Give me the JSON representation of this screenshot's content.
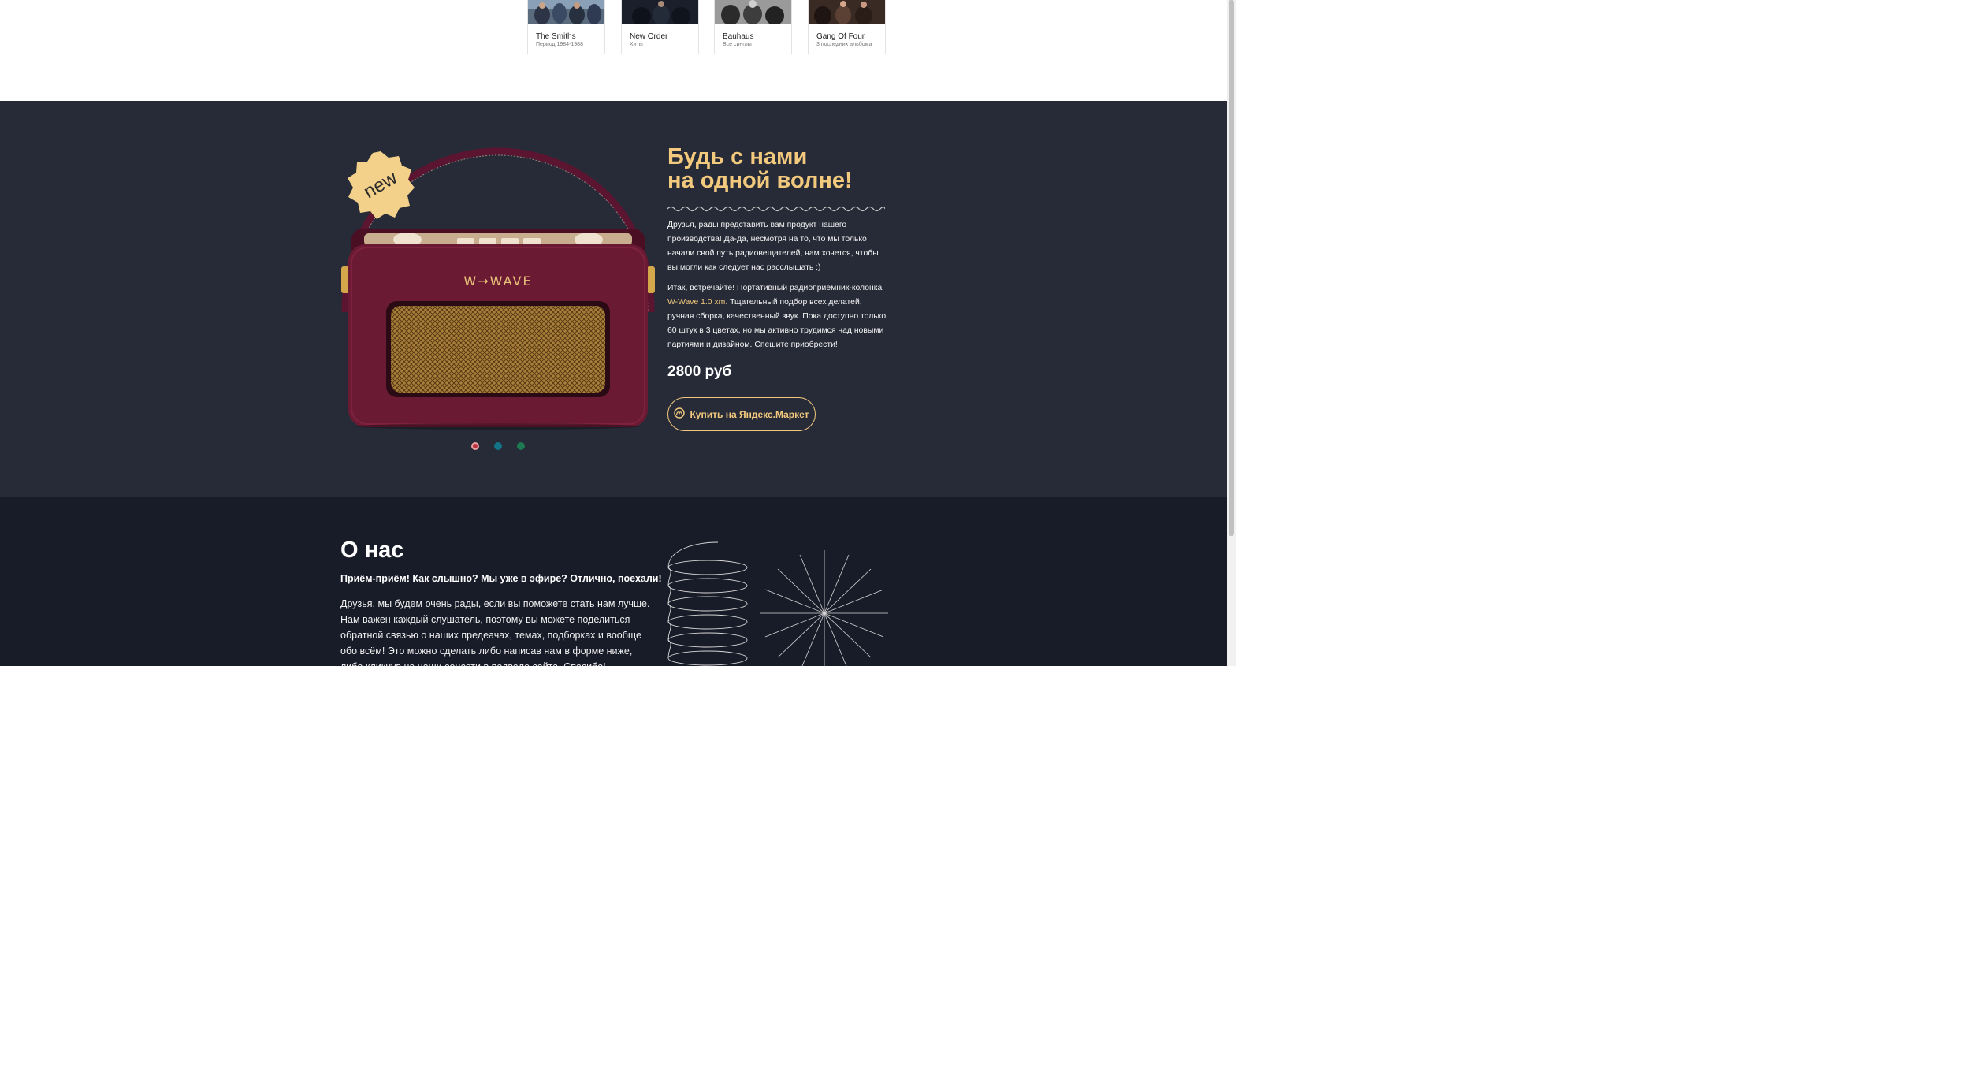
{
  "playlists": [
    {
      "title": "The Smiths",
      "subtitle": "Период 1984-1988"
    },
    {
      "title": "New Order",
      "subtitle": "Хиты"
    },
    {
      "title": "Bauhaus",
      "subtitle": "Все синглы"
    },
    {
      "title": "Gang Of Four",
      "subtitle": "3 последних альбома"
    }
  ],
  "product": {
    "badge": "new",
    "brand": "W→WAVE",
    "headline_line1": "Будь с нами",
    "headline_line2": "на одной волне!",
    "paragraph1": "Друзья, рады представить вам продукт нашего производства! Да-да, несмотря на то, что мы только начали свой путь радиовещателей, нам хочется, чтобы вы могли как следует нас расслышать :)",
    "paragraph2_before": "Итак, встречайте! Портативный радиоприёмник-колонка ",
    "paragraph2_highlight": "W-Wave 1.0 xm.",
    "paragraph2_after": " Тщательный подбор всех делатей, ручная сборка, качественный звук. Пока доступно только 60 штук в 3 цветах, но мы активно трудимся над новыми партиями и дизайном. Спешите приобрести!",
    "price": "2800 руб",
    "buy_label": "Купить на Яндекс.Маркет",
    "color_options": [
      "burgundy",
      "teal",
      "green"
    ],
    "selected_color": "burgundy"
  },
  "about": {
    "title": "О нас",
    "lead": "Приём-приём! Как слышно? Мы уже в эфире? Отлично, поехали!",
    "body": "Друзья, мы будем очень рады, если вы поможете стать нам лучше. Нам важен каждый слушатель, поэтому вы можете поделиться обратной связью о наших предеачах, темах, подборках и вообще обо всём! Это можно сделать либо написав нам в форме ниже, либо кликнув на наши соцсети в подвале сайта. Спасибо!"
  },
  "colors": {
    "accent": "#f2c97d",
    "product_bg": "#272b37",
    "about_bg": "#181b28",
    "radio_body": "#6b1a34",
    "dot_burgundy": "#b8323f",
    "dot_teal": "#127487",
    "dot_green": "#1d7a52"
  }
}
